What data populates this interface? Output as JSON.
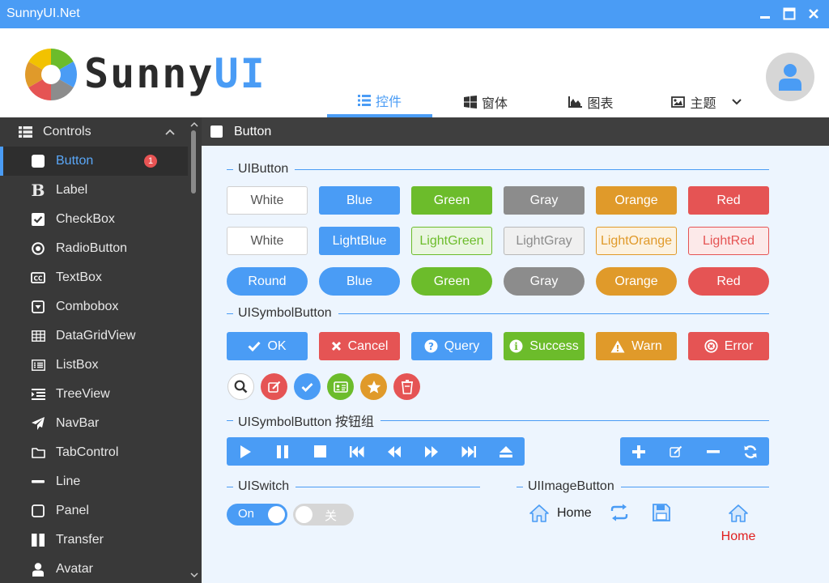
{
  "window": {
    "title": "SunnyUI.Net"
  },
  "header": {
    "logo_text_dark": "Sunny",
    "logo_text_blue": "UI",
    "tabs": [
      {
        "label": "控件",
        "icon": "list-icon"
      },
      {
        "label": "窗体",
        "icon": "windows-icon"
      },
      {
        "label": "图表",
        "icon": "area-chart-icon"
      },
      {
        "label": "主题",
        "icon": "image-icon"
      }
    ]
  },
  "sidebar": {
    "group": "Controls",
    "items": [
      {
        "label": "Button",
        "icon": "square-icon",
        "badge": "1"
      },
      {
        "label": "Label",
        "icon": "bold-icon"
      },
      {
        "label": "CheckBox",
        "icon": "check-square-icon"
      },
      {
        "label": "RadioButton",
        "icon": "dot-circle-icon"
      },
      {
        "label": "TextBox",
        "icon": "closed-captioning-icon"
      },
      {
        "label": "Combobox",
        "icon": "caret-square-down-icon"
      },
      {
        "label": "DataGridView",
        "icon": "table-icon"
      },
      {
        "label": "ListBox",
        "icon": "list-alt-icon"
      },
      {
        "label": "TreeView",
        "icon": "indent-icon"
      },
      {
        "label": "NavBar",
        "icon": "paper-plane-icon"
      },
      {
        "label": "TabControl",
        "icon": "folder-icon"
      },
      {
        "label": "Line",
        "icon": "minus-icon"
      },
      {
        "label": "Panel",
        "icon": "square-outline-icon"
      },
      {
        "label": "Transfer",
        "icon": "columns-icon"
      },
      {
        "label": "Avatar",
        "icon": "user-icon"
      }
    ]
  },
  "page": {
    "title": "Button"
  },
  "sections": {
    "uibutton": "UIButton",
    "symbol": "UISymbolButton",
    "symbol_group": "UISymbolButton 按钮组",
    "switch": "UISwitch",
    "image": "UIImageButton"
  },
  "buttons": {
    "row1": [
      "White",
      "Blue",
      "Green",
      "Gray",
      "Orange",
      "Red"
    ],
    "row2": [
      "White",
      "LightBlue",
      "LightGreen",
      "LightGray",
      "LightOrange",
      "LightRed"
    ],
    "row3": [
      "Round",
      "Blue",
      "Green",
      "Gray",
      "Orange",
      "Red"
    ]
  },
  "symbol_buttons": [
    {
      "label": "OK",
      "icon": "check-icon"
    },
    {
      "label": "Cancel",
      "icon": "close-icon"
    },
    {
      "label": "Query",
      "icon": "question-circle-icon"
    },
    {
      "label": "Success",
      "icon": "info-circle-icon"
    },
    {
      "label": "Warn",
      "icon": "warning-icon"
    },
    {
      "label": "Error",
      "icon": "times-circle-icon"
    }
  ],
  "circle_buttons": [
    "search-icon",
    "edit-icon",
    "check-icon",
    "id-card-icon",
    "star-icon",
    "trash-icon"
  ],
  "media_group": [
    "play-icon",
    "pause-icon",
    "stop-icon",
    "skip-back-icon",
    "rewind-icon",
    "fast-forward-icon",
    "skip-forward-icon",
    "eject-icon"
  ],
  "edit_group": [
    "plus-icon",
    "edit-icon",
    "minus-icon",
    "refresh-icon"
  ],
  "switches": [
    {
      "label": "On",
      "state": "on"
    },
    {
      "label": "关",
      "state": "off"
    }
  ],
  "image_buttons": [
    {
      "label": "Home",
      "icon": "home-icon"
    },
    {
      "label": "",
      "icon": "repeat-icon"
    },
    {
      "label": "",
      "icon": "save-icon"
    },
    {
      "label": "Home",
      "icon": "home-icon"
    }
  ],
  "colors": {
    "primary": "#4a9cf5",
    "green": "#6cbc2b",
    "gray": "#8c8c8c",
    "orange": "#e09a2a",
    "red": "#e55454",
    "sidebar": "#393939"
  }
}
